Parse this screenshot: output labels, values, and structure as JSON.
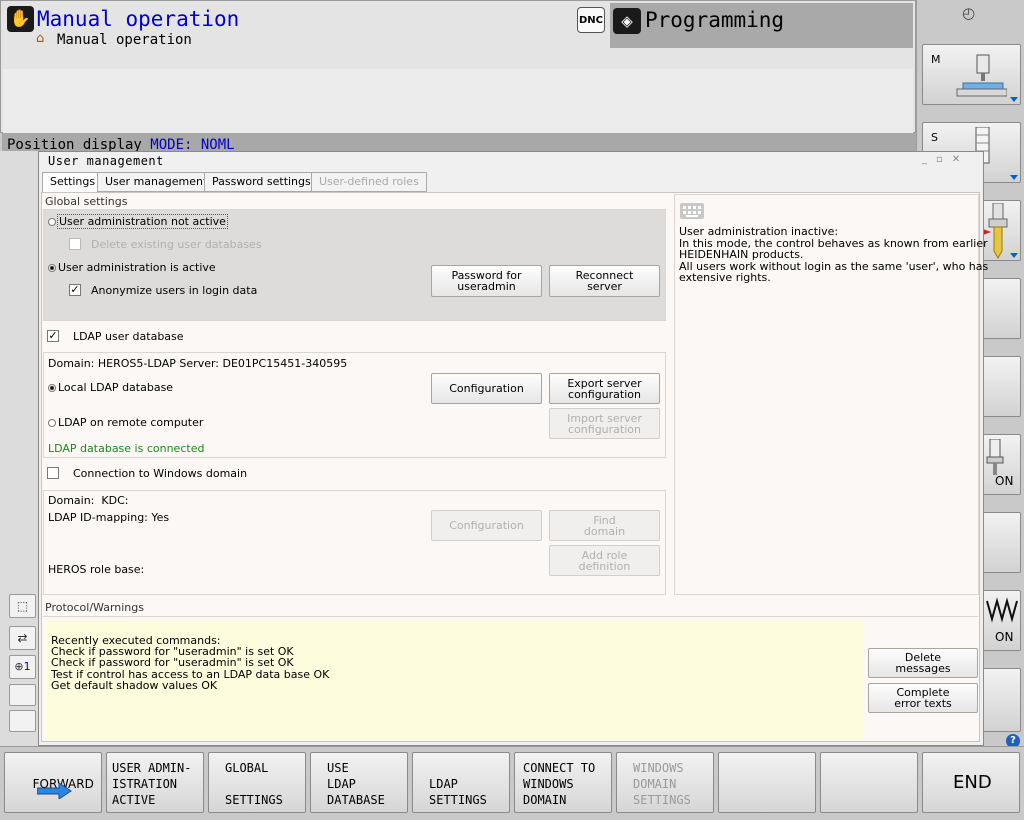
{
  "header": {
    "mode_title": "Manual operation",
    "mode_subtitle": "Manual operation",
    "dnc_label": "DNC",
    "programming_title": "Programming",
    "position_display_label": "Position display",
    "position_display_mode": "MODE: NOML"
  },
  "dialog": {
    "title": "User management",
    "tabs": [
      {
        "label": "Settings",
        "active": true
      },
      {
        "label": "User management",
        "active": false
      },
      {
        "label": "Password settings",
        "active": false
      },
      {
        "label": "User-defined roles",
        "disabled": true
      }
    ],
    "global_settings": {
      "section_label": "Global settings",
      "radio_not_active": "User administration not active",
      "delete_databases": "Delete existing user databases",
      "radio_active": "User administration is active",
      "anonymize": "Anonymize users in login data",
      "btn_password": "Password for useradmin",
      "btn_reconnect": "Reconnect server"
    },
    "ldap": {
      "checkbox": "LDAP user database",
      "domain_line": "Domain: HEROS5-LDAP Server: DE01PC15451-340595",
      "radio_local": "Local LDAP database",
      "radio_remote": "LDAP on remote computer",
      "status": "LDAP database is connected",
      "btn_configuration": "Configuration",
      "btn_export": "Export server configuration",
      "btn_import": "Import server configuration"
    },
    "windows": {
      "checkbox": "Connection to Windows domain",
      "domain_line": "Domain:  KDC:",
      "id_mapping": "LDAP ID-mapping: Yes",
      "role_base": "HEROS role base:",
      "btn_configuration": "Configuration",
      "btn_find": "Find domain",
      "btn_add_role": "Add role definition"
    },
    "info_text": "User administration inactive:\nIn this mode, the control behaves as known from earlier\nHEIDENHAIN products.\nAll users work without login as the same 'user', who has\nextensive rights.",
    "protocol": {
      "label": "Protocol/Warnings",
      "text": "Recently executed commands:\nCheck if password for \"useradmin\" is set OK\nCheck if password for \"useradmin\" is set OK\nTest if control has access to an LDAP data base OK\nGet default shadow values OK",
      "btn_delete": "Delete messages",
      "btn_complete": "Complete error texts"
    }
  },
  "right_softkeys": {
    "m_label": "M",
    "s_label": "S",
    "on1": "ON",
    "on2": "ON"
  },
  "left_col": {
    "counter": "1"
  },
  "bottom_softkeys": [
    {
      "label": "FORWARD"
    },
    {
      "label": "USER ADMIN-\nISTRATION\nACTIVE"
    },
    {
      "label": "GLOBAL\n\nSETTINGS"
    },
    {
      "label": "USE\nLDAP\nDATABASE"
    },
    {
      "label": "\nLDAP\nSETTINGS"
    },
    {
      "label": "CONNECT TO\nWINDOWS\nDOMAIN"
    },
    {
      "label": "WINDOWS\nDOMAIN\nSETTINGS",
      "disabled": true
    },
    {
      "label": ""
    },
    {
      "label": ""
    },
    {
      "label": "END"
    }
  ],
  "colors": {
    "title_blue": "#0000c8",
    "status_green": "#1c8a1c",
    "protocol_bg": "#fdfcdc",
    "help_blue": "#1f5fc0"
  }
}
